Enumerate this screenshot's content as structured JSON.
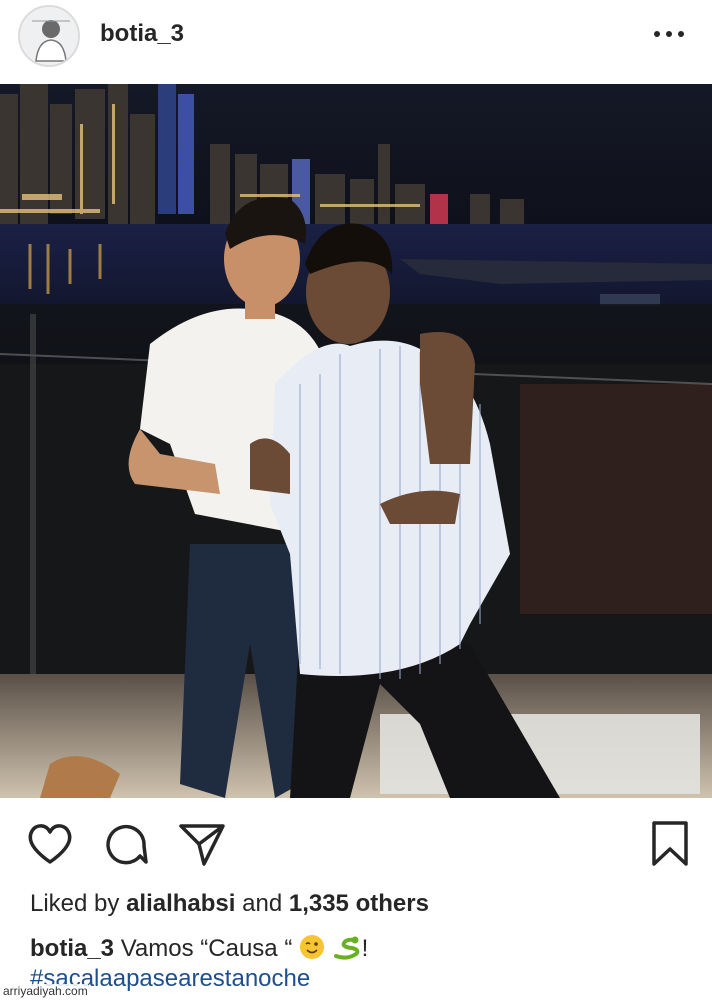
{
  "post": {
    "username": "botia_3",
    "more_icon": "more-dots-icon",
    "photo_alt": "Two men posing at night on a terrace with a city skyline behind them"
  },
  "actions": {
    "like_icon": "heart-icon",
    "comment_icon": "comment-icon",
    "share_icon": "send-icon",
    "save_icon": "bookmark-icon"
  },
  "likes": {
    "prefix": "Liked by ",
    "user": "alialhabsi",
    "middle": " and ",
    "count": "1,335 others"
  },
  "caption": {
    "username": "botia_3",
    "text": " Vamos “Causa “",
    "emoji_1": "😉",
    "emoji_2": "🐍",
    "suffix": "!",
    "hashtag": "#sacalaapasearestanoche"
  },
  "watermark": "arriyadiyah.com",
  "colors": {
    "text": "#262626",
    "hashtag": "#1e4f8c",
    "border": "#dbdbdb"
  }
}
